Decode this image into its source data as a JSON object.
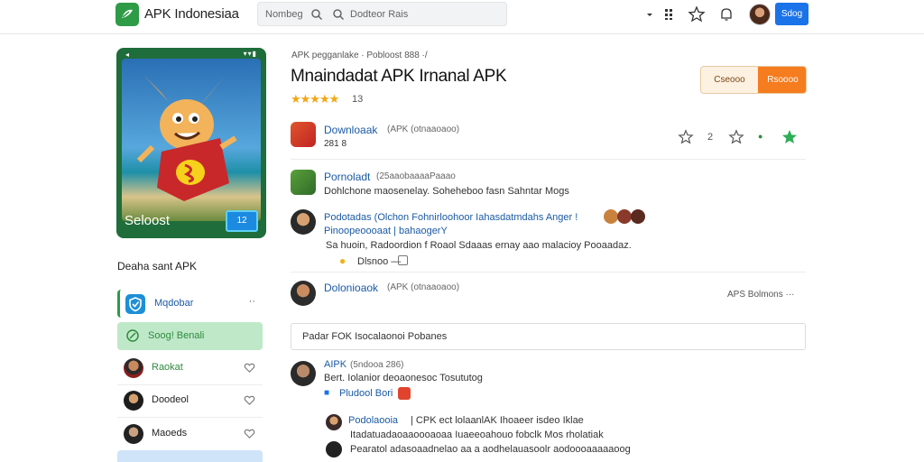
{
  "header": {
    "brand": "APK Indonesiaa",
    "search_label": "Nombeg",
    "search_placeholder": "Dodteor Rais",
    "action_button": "Sdog"
  },
  "hero": {
    "caption": "Seloost",
    "badge": "12",
    "status_left": "◂",
    "status_right": "▾▾▮"
  },
  "sidebar": {
    "heading": "Deaha sant APK",
    "items": [
      {
        "label": "Mqdobar",
        "icon": "shield-icon"
      },
      {
        "label": "Soog! Benali",
        "icon": "leaf-icon"
      },
      {
        "label": "Raokat"
      },
      {
        "label": "Doodeol"
      },
      {
        "label": "Maoeds"
      }
    ]
  },
  "main": {
    "breadcrumb": "APK pegganlake  · Pobloost 888 ·/",
    "title": "Mnaindadat APK Irnanal APK",
    "stars": "★★★★★",
    "rating_count": "13",
    "install_left": "Cseooo",
    "install_right": "Rsoooo",
    "rows": [
      {
        "title": "Downloaak",
        "meta": "(APK (otnaaoaoo)",
        "sub": "281  8"
      },
      {
        "title": "Pornoladt",
        "meta": "(25aaobaaaaPaaao",
        "sub": "Dohlchone maosenelay. Soheheboo fasn Sahntar Mogs"
      },
      {
        "title": "Podotadas (Olchon Fohnirloohoor Iahasdatmdahs Anger !",
        "line2": "Pinoopeoooaat | bahaogerY",
        "line3": "Sa huoin, Radoordion f Roaol Sdaaas ernay aao malacioy Pooaadaz.",
        "line4": "Dlsnoo —"
      },
      {
        "title": "Dolonioaok",
        "meta": "(APK (otnaaoaoo)",
        "right": "APS Bolmons ···"
      }
    ],
    "reply_box": "Padar FOK   Isocalaonoi Pobanes",
    "comment": {
      "title": "AIPK",
      "meta": "(5ndooa 286)",
      "line1": "Bert. Iolanior deoaonesoc Tosututog",
      "line2": "Pludool Bori",
      "reply_title": "Podolaooia",
      "reply_meta": "| CPK ect lolaanlAK Ihoaeer isdeo Iklae",
      "reply_line2": "Itadatuadaoaaoooaoaa Iuaeeoahouo fobclk Mos rholatiak",
      "reply_line3": "Pearatol adasoaadnelao aa a aodhelauasoolr aodoooaaaaaoog"
    }
  },
  "colors": {
    "accent_blue": "#1a73e8",
    "link_blue": "#1a5aa5",
    "brand_green": "#2e9b46",
    "orange": "#f57c1f",
    "star_gold": "#f2a614"
  }
}
